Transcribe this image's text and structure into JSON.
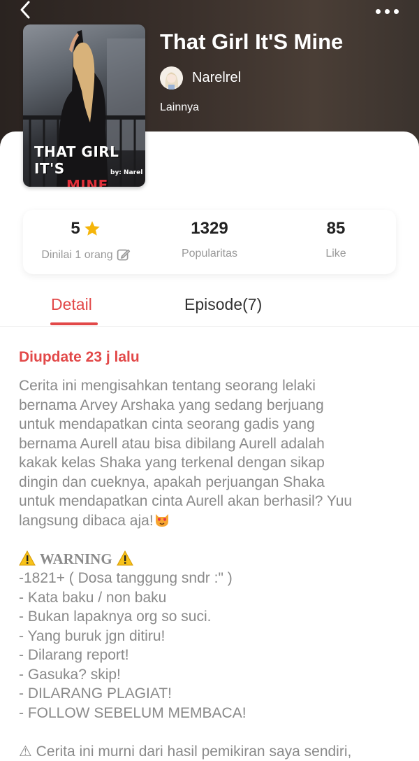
{
  "nav": {
    "back_icon": "chevron-left-icon",
    "more_icon": "more-dots-icon"
  },
  "book": {
    "title": "That Girl It'S Mine",
    "author": "Narelrel",
    "category": "Lainnya",
    "cover": {
      "title_line1": "THAT GIRL IT'S",
      "title_line2": "MINE",
      "byline": "by: Narel"
    }
  },
  "stats": {
    "rating": {
      "value": "5",
      "label": "Dinilai 1 orang"
    },
    "popularity": {
      "value": "1329",
      "label": "Popularitas"
    },
    "likes": {
      "value": "85",
      "label": "Like"
    }
  },
  "tabs": [
    {
      "label": "Detail",
      "active": true
    },
    {
      "label": "Episode(7)",
      "active": false
    }
  ],
  "detail": {
    "updated": "Diupdate 23 j lalu",
    "description_lines": [
      "Cerita ini mengisahkan tentang seorang lelaki",
      "bernama Arvey Arshaka yang sedang berjuang",
      "untuk mendapatkan cinta seorang gadis yang",
      "bernama Aurell atau bisa dibilang Aurell adalah",
      "kakak kelas Shaka yang terkenal dengan sikap",
      "dingin dan cueknya, apakah perjuangan Shaka",
      "untuk mendapatkan cinta Aurell akan berhasil? Yuu",
      "langsung dibaca aja!"
    ],
    "warning_title": "WARNING",
    "warning_items": [
      "-1821+ ( Dosa tanggung sndr :\" )",
      "- Kata baku / non baku",
      "- Bukan lapaknya org so suci.",
      "- Yang buruk jgn ditiru!",
      "- Dilarang report!",
      "- Gasuka? skip!",
      "- DILARANG PLAGIAT!",
      "- FOLLOW SEBELUM MEMBACA!"
    ],
    "footer_note": "⚠ Cerita ini murni dari hasil pemikiran saya sendiri,"
  },
  "colors": {
    "accent": "#e24848",
    "header_bg": "#3a302b",
    "muted_text": "#8a8a8a",
    "star": "#f5b50a"
  }
}
